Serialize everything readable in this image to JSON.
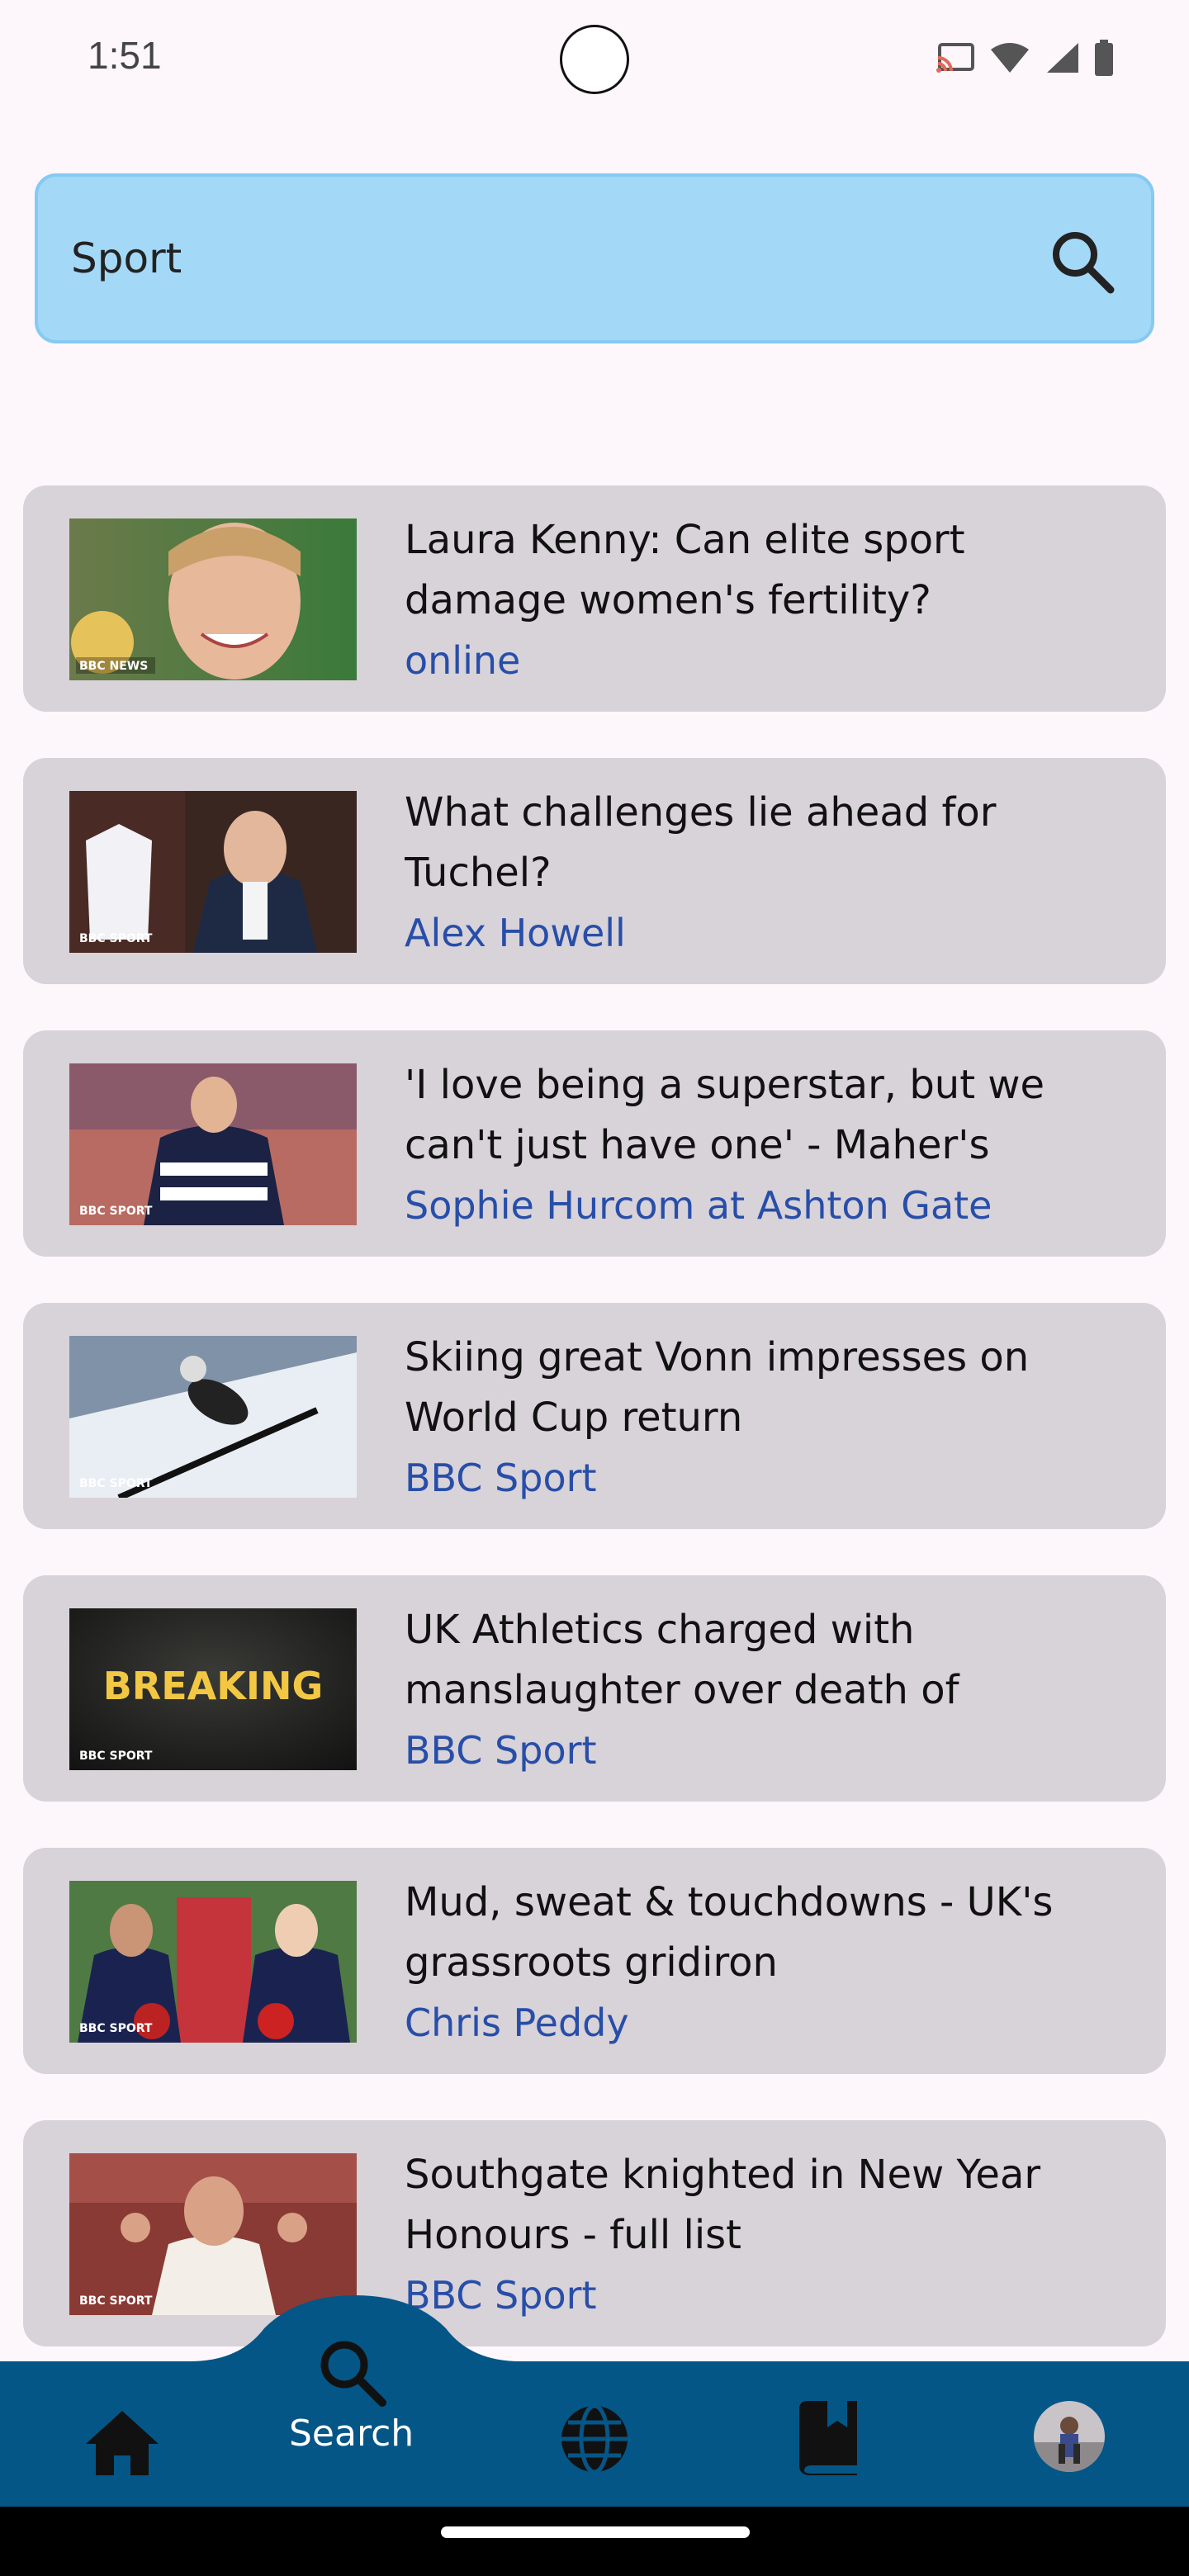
{
  "status_bar": {
    "time": "1:51",
    "icons": [
      "cast-icon",
      "wifi-icon",
      "signal-icon",
      "battery-icon"
    ]
  },
  "search": {
    "value": "Sport",
    "icon": "search-icon"
  },
  "results": [
    {
      "title": "Laura Kenny: Can elite sport damage women's fertility?",
      "author": "online",
      "thumb_badge": "BBC NEWS"
    },
    {
      "title": "What challenges lie ahead for Tuchel?",
      "author": "Alex Howell",
      "thumb_badge": "BBC SPORT"
    },
    {
      "title": "'I love being a superstar, but we can't just have one' - Maher's",
      "author": "Sophie Hurcom at Ashton Gate",
      "thumb_badge": "BBC SPORT"
    },
    {
      "title": "Skiing great Vonn impresses on World Cup return",
      "author": "BBC Sport",
      "thumb_badge": "BBC SPORT"
    },
    {
      "title": "UK Athletics charged with manslaughter over death of",
      "author": "BBC Sport",
      "thumb_badge": "BBC SPORT",
      "thumb_text": "BREAKING"
    },
    {
      "title": "Mud, sweat & touchdowns - UK's grassroots gridiron",
      "author": "Chris Peddy",
      "thumb_badge": "BBC SPORT"
    },
    {
      "title": "Southgate knighted in New Year Honours - full list",
      "author": "BBC Sport",
      "thumb_badge": "BBC SPORT"
    }
  ],
  "nav": {
    "active_label": "Search",
    "items": [
      "home-icon",
      "search-icon",
      "globe-icon",
      "bookmark-book-icon",
      "profile-avatar"
    ]
  },
  "colors": {
    "background": "#fdf7fc",
    "search_bar": "#a4d8f7",
    "card": "#d8d2d9",
    "author_text": "#274ea8",
    "nav_bar": "#045687"
  }
}
